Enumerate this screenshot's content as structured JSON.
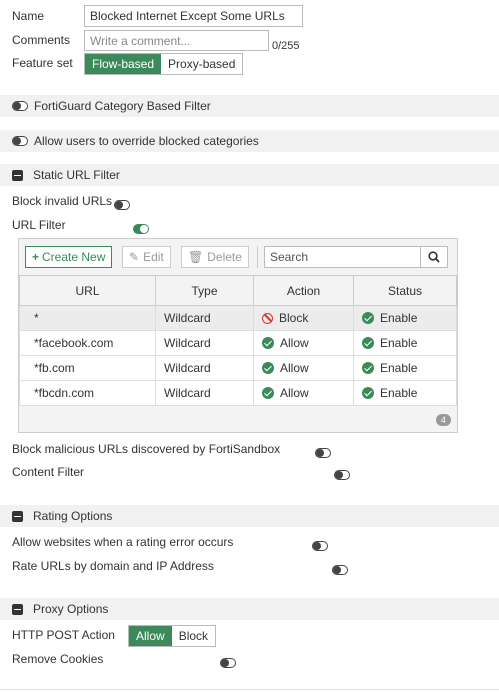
{
  "form": {
    "name_label": "Name",
    "name_value": "Blocked Internet Except Some URLs",
    "comments_label": "Comments",
    "comments_placeholder": "Write a comment...",
    "comments_counter": "0/255",
    "feature_set_label": "Feature set",
    "feature_set_options": [
      "Flow-based",
      "Proxy-based"
    ],
    "feature_set_selected": "Flow-based"
  },
  "toggles": {
    "fortiguard_category": {
      "label": "FortiGuard Category Based Filter",
      "state": "off"
    },
    "allow_override": {
      "label": "Allow users to override blocked categories",
      "state": "off"
    }
  },
  "static_url_filter": {
    "title": "Static URL Filter",
    "block_invalid_label": "Block invalid URLs",
    "block_invalid_state": "off",
    "url_filter_label": "URL Filter",
    "url_filter_state": "on",
    "toolbar": {
      "create_new": "Create New",
      "edit": "Edit",
      "delete": "Delete",
      "search_placeholder": "Search"
    },
    "columns": [
      "URL",
      "Type",
      "Action",
      "Status"
    ],
    "rows": [
      {
        "url": "*",
        "type": "Wildcard",
        "action": "Block",
        "status": "Enable"
      },
      {
        "url": "*facebook.com",
        "type": "Wildcard",
        "action": "Allow",
        "status": "Enable"
      },
      {
        "url": "*fb.com",
        "type": "Wildcard",
        "action": "Allow",
        "status": "Enable"
      },
      {
        "url": "*fbcdn.com",
        "type": "Wildcard",
        "action": "Allow",
        "status": "Enable"
      }
    ],
    "count": "4",
    "block_malicious_label": "Block malicious URLs discovered by FortiSandbox",
    "block_malicious_state": "off",
    "content_filter_label": "Content Filter",
    "content_filter_state": "off"
  },
  "rating_options": {
    "title": "Rating Options",
    "allow_on_error_label": "Allow websites when a rating error occurs",
    "allow_on_error_state": "off",
    "rate_by_ip_label": "Rate URLs by domain and IP Address",
    "rate_by_ip_state": "off"
  },
  "proxy_options": {
    "title": "Proxy Options",
    "http_post_label": "HTTP POST Action",
    "http_post_options": [
      "Allow",
      "Block"
    ],
    "http_post_selected": "Allow",
    "remove_cookies_label": "Remove Cookies",
    "remove_cookies_state": "off"
  },
  "colors": {
    "accent": "#3c8a5a",
    "block": "#d9322d",
    "section_bg": "#f1f1f1"
  }
}
